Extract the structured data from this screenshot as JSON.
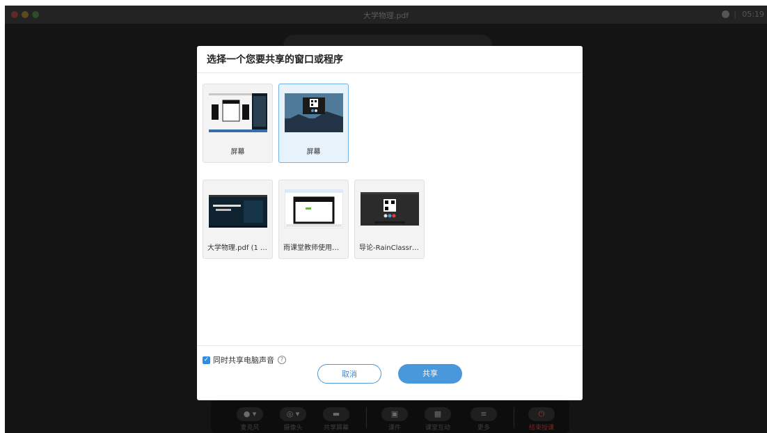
{
  "window": {
    "title": "大学物理.pdf",
    "time": "05:19"
  },
  "dialog": {
    "title": "选择一个您要共享的窗口或程序",
    "cards": [
      {
        "label": "屏幕",
        "kind": "screen",
        "selected": false
      },
      {
        "label": "屏幕",
        "kind": "screen",
        "selected": true
      },
      {
        "label": "大学物理.pdf (1 p...",
        "kind": "window",
        "selected": false
      },
      {
        "label": "雨课堂教师使用手...",
        "kind": "window",
        "selected": false
      },
      {
        "label": "导论-RainClassro...",
        "kind": "window",
        "selected": false
      }
    ],
    "share_audio": {
      "label": "同时共享电脑声音",
      "checked": true
    },
    "cancel_label": "取消",
    "share_label": "共享"
  },
  "toolbar": {
    "items": [
      {
        "label": "麦克风",
        "icon": "microphone-icon"
      },
      {
        "label": "摄像头",
        "icon": "camera-icon"
      },
      {
        "label": "共享屏幕",
        "icon": "share-screen-icon"
      },
      {
        "label": "课件",
        "icon": "slides-icon"
      },
      {
        "label": "课堂互动",
        "icon": "apps-grid-icon"
      },
      {
        "label": "更多",
        "icon": "menu-icon"
      },
      {
        "label": "结束授课",
        "icon": "power-icon"
      }
    ]
  },
  "colors": {
    "accent": "#4a98dc",
    "selected_card_bg": "#e8f2fb",
    "end_red": "#a33030"
  }
}
